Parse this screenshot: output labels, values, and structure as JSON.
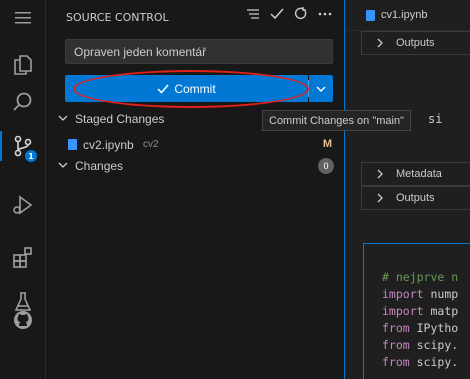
{
  "sidebar": {
    "title": "SOURCE CONTROL",
    "commit_message": "Opraven jeden komentář",
    "commit_label": "Commit",
    "staged": {
      "label": "Staged Changes"
    },
    "staged_file": {
      "name": "cv2.ipynb",
      "dir": "cv2",
      "status": "M"
    },
    "changes": {
      "label": "Changes",
      "count": "0"
    }
  },
  "activity_bar": {
    "scm_badge": "1",
    "icons": [
      "menu-icon",
      "explorer-icon",
      "search-icon",
      "source-control-icon",
      "run-debug-icon",
      "extensions-icon",
      "testing-icon",
      "github-icon"
    ]
  },
  "tooltip": {
    "text": "Commit Changes on \"main\""
  },
  "editor": {
    "tab_name": "cv1.ipynb",
    "rows": [
      "Outputs",
      "Metadata",
      "Outputs"
    ],
    "code_fragment": "si",
    "code_lines": [
      {
        "kw": "",
        "text": "# nejprve n",
        "comment": true
      },
      {
        "kw": "import",
        "text": " nump"
      },
      {
        "kw": "import",
        "text": " matp"
      },
      {
        "kw": "from",
        "text": " IPytho"
      },
      {
        "kw": "from",
        "text": " scipy."
      },
      {
        "kw": "from",
        "text": " scipy."
      }
    ]
  },
  "colors": {
    "accent": "#0078d4",
    "annotation": "#e0201a",
    "modified": "#e2c08d"
  }
}
